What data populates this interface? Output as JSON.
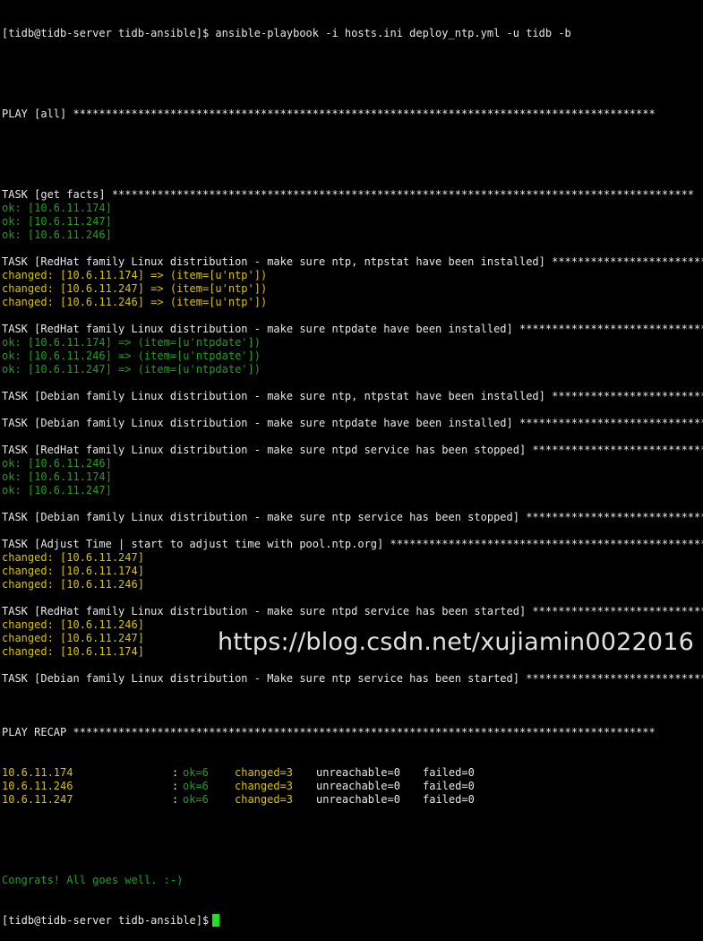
{
  "terminal": {
    "command_line": "[tidb@tidb-server tidb-ansible]$ ansible-playbook -i hosts.ini deploy_ntp.yml -u tidb -b",
    "play": "PLAY [all] ******************************************************************************************",
    "tasks": [
      {
        "header": "TASK [get facts] ******************************************************************************************",
        "lines": [
          {
            "text": "ok: [10.6.11.174]",
            "color": "#1fa01f"
          },
          {
            "text": "ok: [10.6.11.247]",
            "color": "#1fa01f"
          },
          {
            "text": "ok: [10.6.11.246]",
            "color": "#1fa01f"
          }
        ]
      },
      {
        "header": "TASK [RedHat family Linux distribution - make sure ntp, ntpstat have been installed] ******************************************************************************************",
        "lines": [
          {
            "text": "changed: [10.6.11.174] => (item=[u'ntp'])",
            "color": "#d8c300"
          },
          {
            "text": "changed: [10.6.11.247] => (item=[u'ntp'])",
            "color": "#d8c300"
          },
          {
            "text": "changed: [10.6.11.246] => (item=[u'ntp'])",
            "color": "#d8c300"
          }
        ]
      },
      {
        "header": "TASK [RedHat family Linux distribution - make sure ntpdate have been installed] ******************************************************************************************",
        "lines": [
          {
            "text": "ok: [10.6.11.174] => (item=[u'ntpdate'])",
            "color": "#1fa01f"
          },
          {
            "text": "ok: [10.6.11.246] => (item=[u'ntpdate'])",
            "color": "#1fa01f"
          },
          {
            "text": "ok: [10.6.11.247] => (item=[u'ntpdate'])",
            "color": "#1fa01f"
          }
        ]
      },
      {
        "header": "TASK [Debian family Linux distribution - make sure ntp, ntpstat have been installed] ******************************************************************************************",
        "lines": []
      },
      {
        "header": "TASK [Debian family Linux distribution - make sure ntpdate have been installed] ******************************************************************************************",
        "lines": []
      },
      {
        "header": "TASK [RedHat family Linux distribution - make sure ntpd service has been stopped] ******************************************************************************************",
        "lines": [
          {
            "text": "ok: [10.6.11.246]",
            "color": "#1fa01f"
          },
          {
            "text": "ok: [10.6.11.174]",
            "color": "#1fa01f"
          },
          {
            "text": "ok: [10.6.11.247]",
            "color": "#1fa01f"
          }
        ]
      },
      {
        "header": "TASK [Debian family Linux distribution - make sure ntp service has been stopped] ******************************************************************************************",
        "lines": []
      },
      {
        "header": "TASK [Adjust Time | start to adjust time with pool.ntp.org] ******************************************************************************************",
        "lines": [
          {
            "text": "changed: [10.6.11.247]",
            "color": "#d8c300"
          },
          {
            "text": "changed: [10.6.11.174]",
            "color": "#d8c300"
          },
          {
            "text": "changed: [10.6.11.246]",
            "color": "#d8c300"
          }
        ]
      },
      {
        "header": "TASK [RedHat family Linux distribution - make sure ntpd service has been started] ******************************************************************************************",
        "lines": [
          {
            "text": "changed: [10.6.11.246]",
            "color": "#d8c300"
          },
          {
            "text": "changed: [10.6.11.247]",
            "color": "#d8c300"
          },
          {
            "text": "changed: [10.6.11.174]",
            "color": "#d8c300"
          }
        ]
      },
      {
        "header": "TASK [Debian family Linux distribution - Make sure ntp service has been started] ******************************************************************************************",
        "lines": []
      }
    ],
    "recap_header": "PLAY RECAP ******************************************************************************************",
    "recap": [
      {
        "host": "10.6.11.174",
        "sep": ":",
        "ok": "ok=6",
        "changed": "changed=3",
        "unreachable": "unreachable=0",
        "failed": "failed=0"
      },
      {
        "host": "10.6.11.246",
        "sep": ":",
        "ok": "ok=6",
        "changed": "changed=3",
        "unreachable": "unreachable=0",
        "failed": "failed=0"
      },
      {
        "host": "10.6.11.247",
        "sep": ":",
        "ok": "ok=6",
        "changed": "changed=3",
        "unreachable": "unreachable=0",
        "failed": "failed=0"
      }
    ],
    "congrats": "Congrats! All goes well. :-)",
    "prompt": "[tidb@tidb-server tidb-ansible]$"
  },
  "colors": {
    "background": "#000000",
    "text": "#e8e8e8",
    "ok": "#1fa01f",
    "changed": "#d8c300",
    "cursor": "#22e022"
  },
  "watermark": "https://blog.csdn.net/xujiamin0022016"
}
